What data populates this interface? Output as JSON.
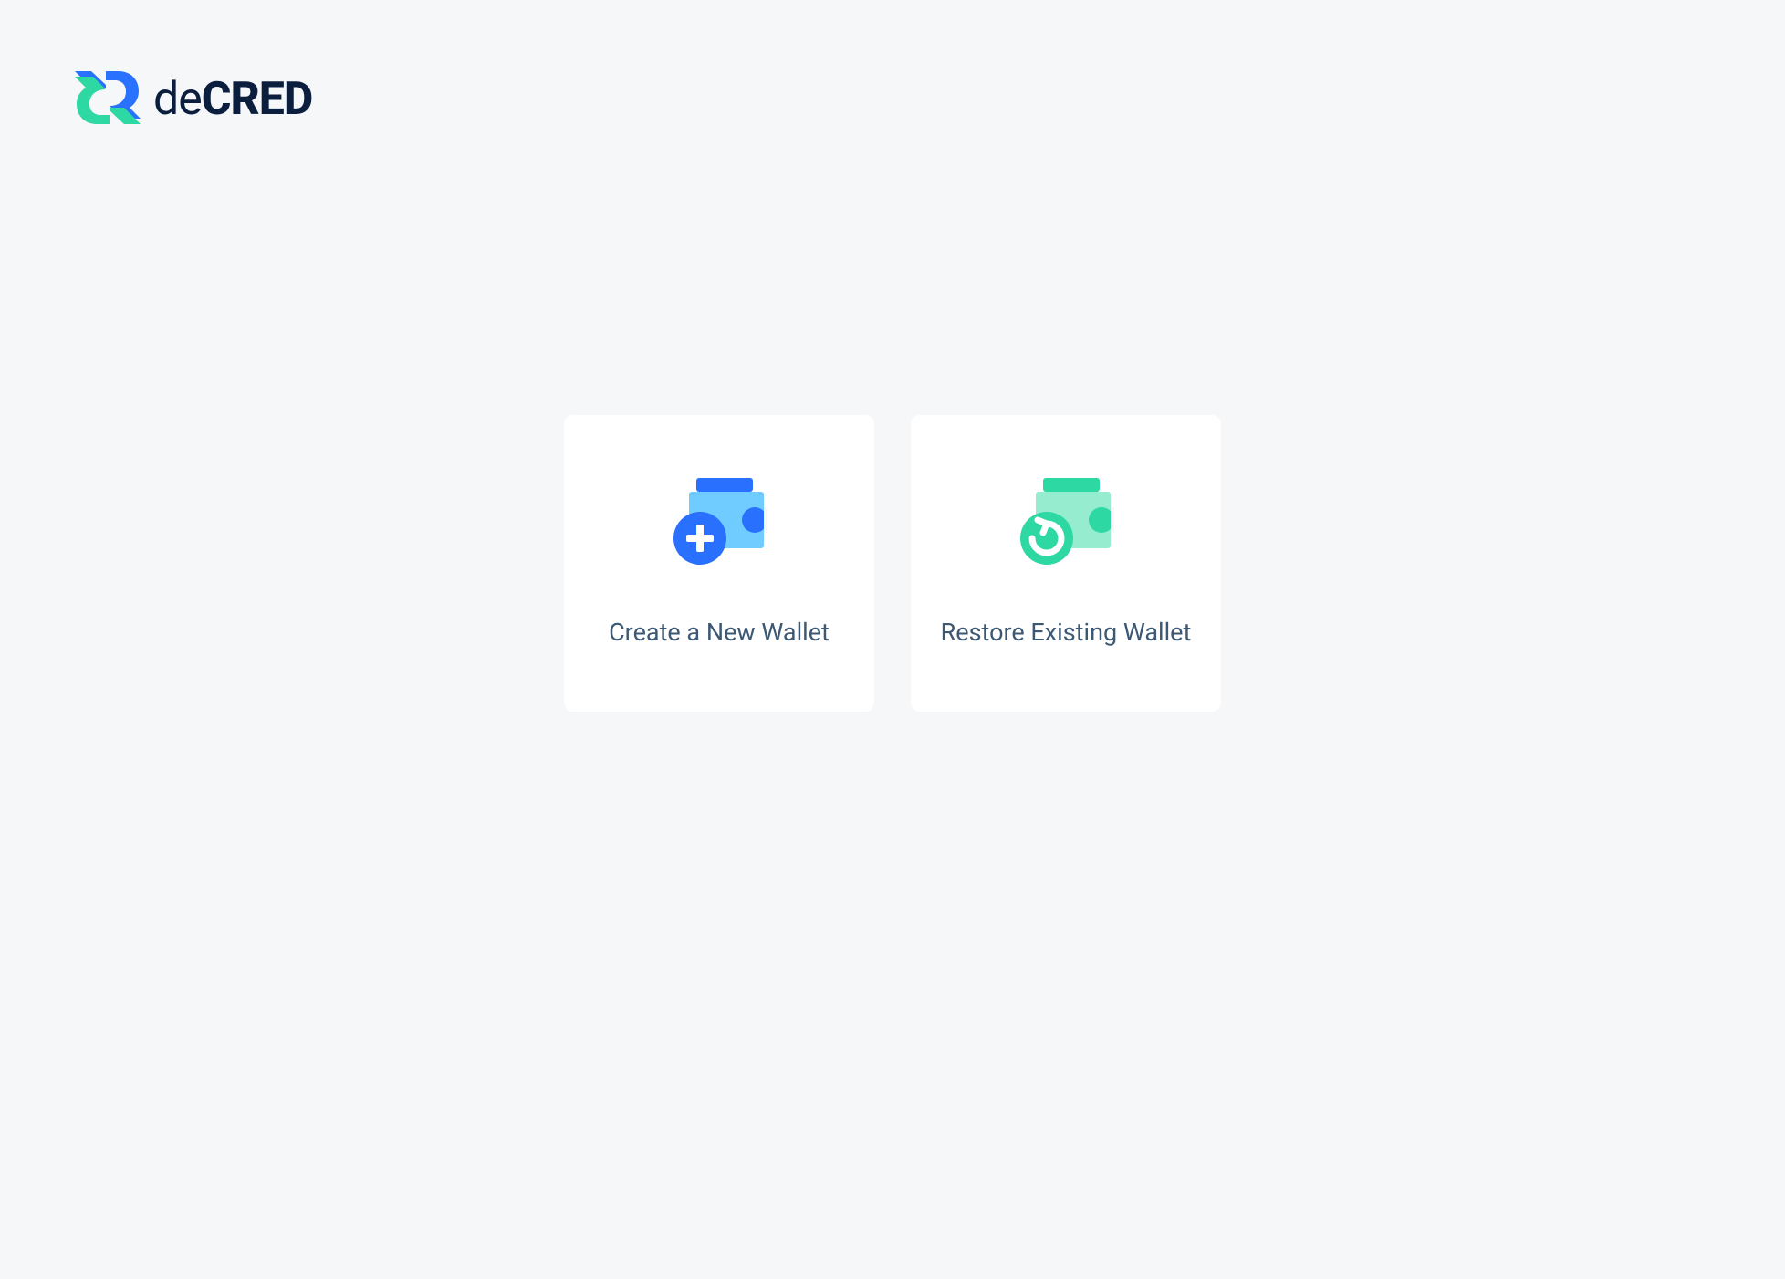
{
  "brand": {
    "name_light": "de",
    "name_bold": "CRED"
  },
  "cards": {
    "create": {
      "label": "Create a New Wallet"
    },
    "restore": {
      "label": "Restore Existing Wallet"
    }
  }
}
